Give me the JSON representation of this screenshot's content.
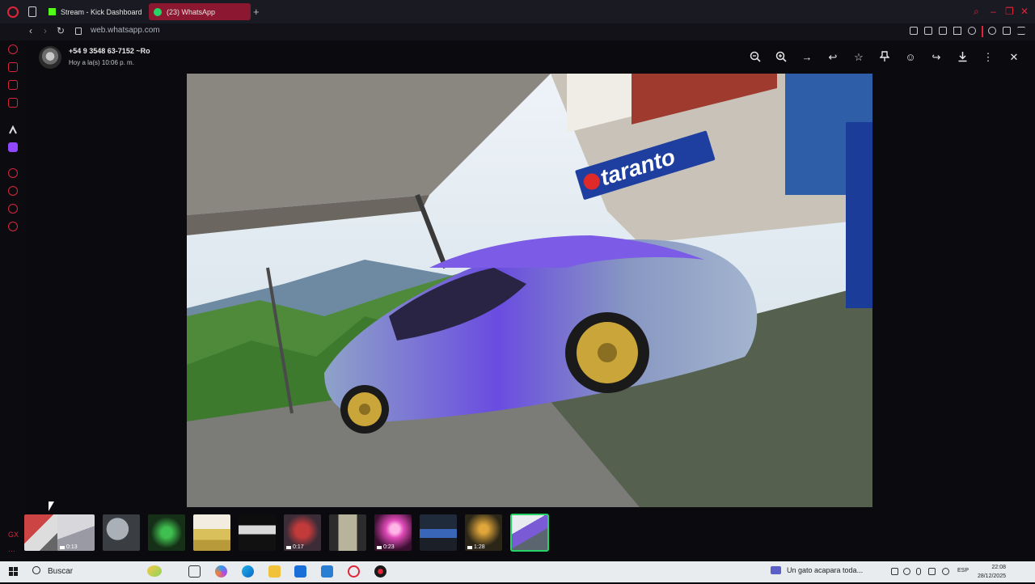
{
  "browser": {
    "tabs": [
      {
        "label": "Stream - Kick Dashboard",
        "active": false
      },
      {
        "label": "(23) WhatsApp",
        "active": true
      }
    ],
    "url": "web.whatsapp.com",
    "accent_color": "#e0243a"
  },
  "viewer": {
    "contact_name": "+54 9 3548 63-7152 ~Ro",
    "timestamp": "Hoy a la(s) 10:06 p. m.",
    "toolbar_icons": [
      "zoom-out-icon",
      "zoom-in-icon",
      "forward-arrow-icon",
      "reply-icon",
      "star-icon",
      "pin-icon",
      "emoji-icon",
      "share-icon",
      "download-icon",
      "more-icon",
      "close-icon"
    ],
    "photo_sign_text": "taranto",
    "thumbnails": [
      {
        "duration": ""
      },
      {
        "duration": "0:13"
      },
      {
        "duration": ""
      },
      {
        "duration": ""
      },
      {
        "duration": ""
      },
      {
        "duration": ""
      },
      {
        "duration": "0:17"
      },
      {
        "duration": ""
      },
      {
        "duration": "0:23"
      },
      {
        "duration": ""
      },
      {
        "duration": "1:28"
      },
      {
        "duration": "",
        "selected": true
      }
    ]
  },
  "taskbar": {
    "search_label": "Buscar",
    "news_text": "Un gato acapara toda...",
    "language": "ESP",
    "time": "22:08",
    "date": "28/12/2025"
  }
}
